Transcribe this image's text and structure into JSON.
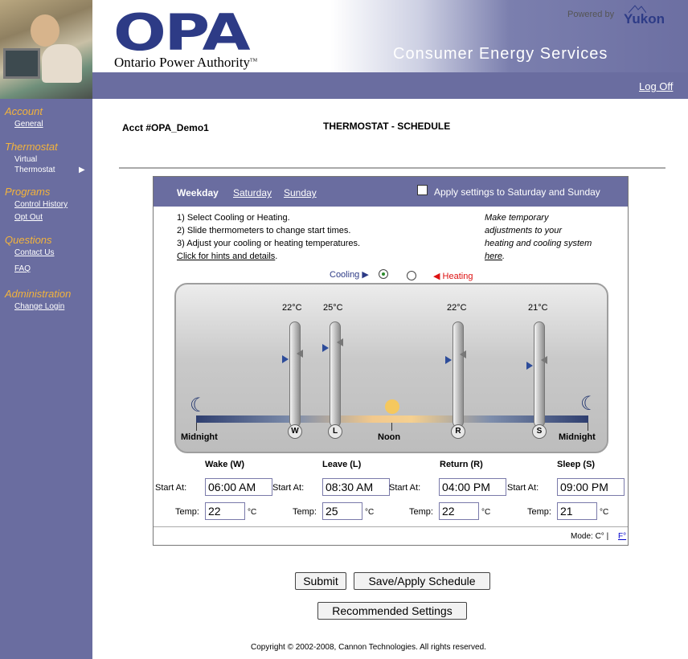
{
  "header": {
    "logo_text": "OPA",
    "org_name": "Ontario Power Authority",
    "org_tm": "TM",
    "powered_by": "Powered by",
    "vendor": "Yukon",
    "service_title": "Consumer Energy Services",
    "logoff": "Log Off"
  },
  "sidebar": {
    "sections": [
      {
        "heading": "Account",
        "links": [
          "General"
        ]
      },
      {
        "heading": "Thermostat",
        "links": [
          "Virtual",
          "Thermostat"
        ]
      },
      {
        "heading": "Programs",
        "links": [
          "Control History",
          "Opt Out"
        ]
      },
      {
        "heading": "Questions",
        "links": [
          "Contact Us",
          "FAQ"
        ]
      },
      {
        "heading": "Administration",
        "links": [
          "Change Login"
        ]
      }
    ],
    "active_arrow": "▶"
  },
  "main": {
    "account": "Acct #OPA_Demo1",
    "page_title": "THERMOSTAT - SCHEDULE",
    "tabs": [
      "Weekday",
      "Saturday",
      "Sunday"
    ],
    "active_tab": "Weekday",
    "apply_label": "Apply settings to Saturday and Sunday",
    "instructions": [
      "1) Select Cooling or Heating.",
      "2) Slide thermometers to change start times.",
      "3) Adjust your cooling or heating temperatures."
    ],
    "hints_link": "Click for hints and details",
    "hints_period": ".",
    "temporary_lines": [
      "Make temporary",
      "adjustments to your",
      "heating and cooling system"
    ],
    "temporary_link": "here",
    "temporary_period": ".",
    "cooling_label": "Cooling",
    "heating_label": "Heating",
    "selected_mode": "Cooling",
    "axis": {
      "start": "Midnight",
      "mid": "Noon",
      "end": "Midnight"
    },
    "periods": [
      {
        "name": "Wake (W)",
        "letter": "W",
        "temp_display": "22°C",
        "start_at": "06:00 AM",
        "temp": "22",
        "hour": 6.0
      },
      {
        "name": "Leave (L)",
        "letter": "L",
        "temp_display": "25°C",
        "start_at": "08:30 AM",
        "temp": "25",
        "hour": 8.5
      },
      {
        "name": "Return (R)",
        "letter": "R",
        "temp_display": "22°C",
        "start_at": "04:00 PM",
        "temp": "22",
        "hour": 16.0
      },
      {
        "name": "Sleep (S)",
        "letter": "S",
        "temp_display": "21°C",
        "start_at": "09:00 PM",
        "temp": "21",
        "hour": 21.0
      }
    ],
    "start_label": "Start At:",
    "temp_label": "Temp:",
    "unit": "°C",
    "mode_label": "Mode: C°",
    "mode_sep": "|",
    "mode_f": "F°"
  },
  "buttons": {
    "submit": "Submit",
    "save": "Save/Apply Schedule",
    "recommended": "Recommended Settings"
  },
  "footer": {
    "copyright": "Copyright © 2002-2008, Cannon Technologies. All rights reserved."
  },
  "colors": {
    "nav_purple": "#6a6da0",
    "heading_orange": "#f3b33c",
    "logo_blue": "#2d3b86"
  }
}
